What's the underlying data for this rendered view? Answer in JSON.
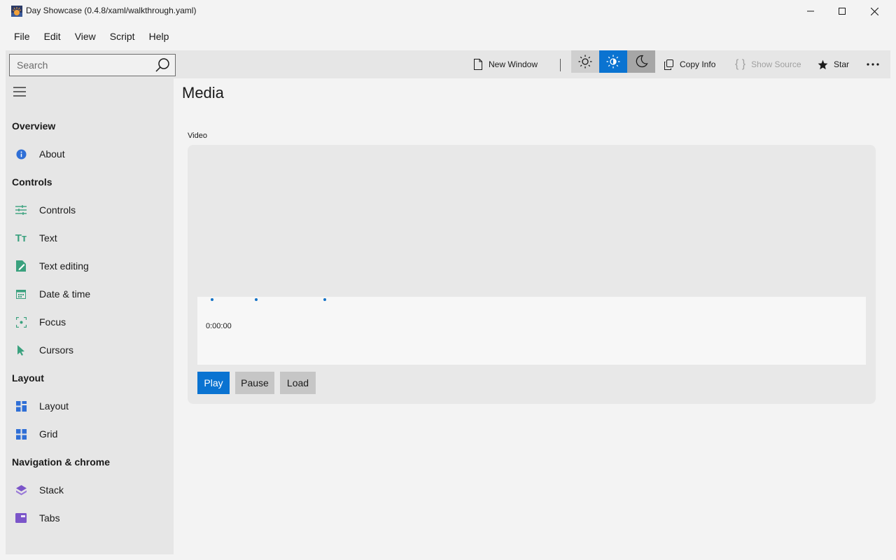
{
  "window": {
    "title": "Day Showcase (0.4.8/xaml/walkthrough.yaml)"
  },
  "menu": {
    "items": [
      "File",
      "Edit",
      "View",
      "Script",
      "Help"
    ]
  },
  "toolbar": {
    "search_placeholder": "Search",
    "new_window": "New Window",
    "copy_info": "Copy Info",
    "show_source": "Show Source",
    "star": "Star",
    "theme_selected": "high-contrast-sun",
    "accent_color": "#0a73d1"
  },
  "sidebar": {
    "sections": [
      {
        "title": "Overview",
        "items": [
          {
            "label": "About",
            "icon": "info-icon"
          }
        ]
      },
      {
        "title": "Controls",
        "items": [
          {
            "label": "Controls",
            "icon": "sliders-icon"
          },
          {
            "label": "Text",
            "icon": "text-icon"
          },
          {
            "label": "Text editing",
            "icon": "edit-doc-icon"
          },
          {
            "label": "Date & time",
            "icon": "calendar-icon"
          },
          {
            "label": "Focus",
            "icon": "focus-icon"
          },
          {
            "label": "Cursors",
            "icon": "cursor-icon"
          }
        ]
      },
      {
        "title": "Layout",
        "items": [
          {
            "label": "Layout",
            "icon": "layout-icon"
          },
          {
            "label": "Grid",
            "icon": "grid-icon"
          }
        ]
      },
      {
        "title": "Navigation & chrome",
        "items": [
          {
            "label": "Stack",
            "icon": "stack-icon"
          },
          {
            "label": "Tabs",
            "icon": "tabs-icon"
          }
        ]
      }
    ]
  },
  "main": {
    "page_title": "Media",
    "video_label": "Video",
    "player": {
      "time": "0:00:00",
      "buttons": {
        "play": "Play",
        "pause": "Pause",
        "load": "Load"
      }
    }
  }
}
